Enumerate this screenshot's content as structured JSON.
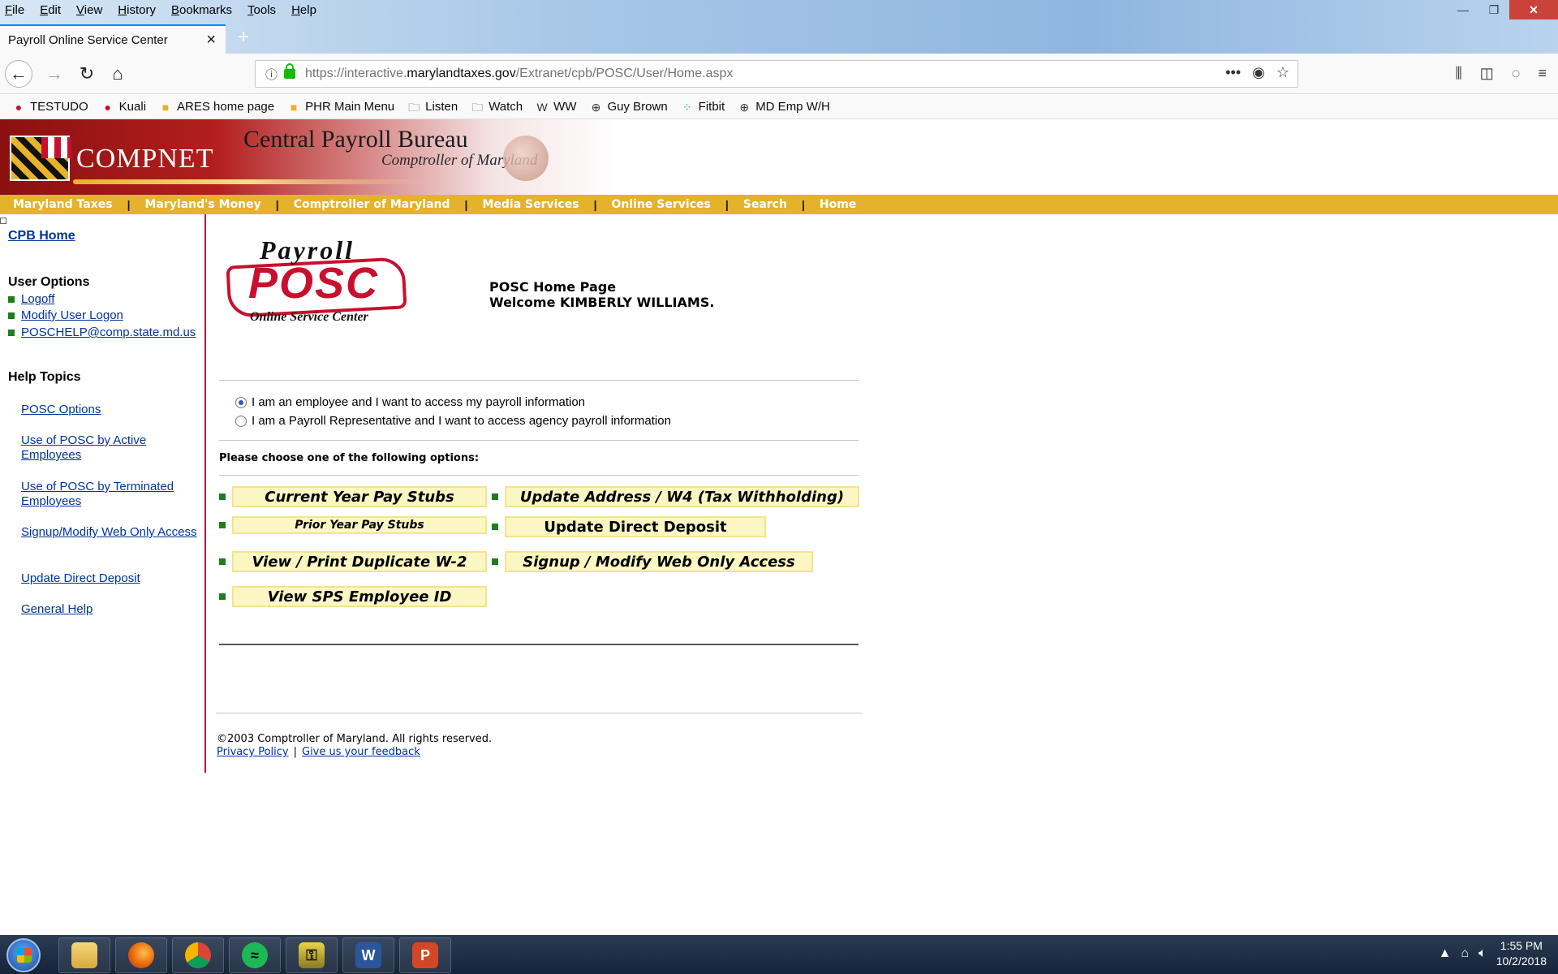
{
  "browser": {
    "menu": [
      "File",
      "Edit",
      "View",
      "History",
      "Bookmarks",
      "Tools",
      "Help"
    ],
    "tab_title": "Payroll Online Service Center",
    "url_prefix": "https://interactive.",
    "url_domain": "marylandtaxes.gov",
    "url_path": "/Extranet/cpb/POSC/User/Home.aspx",
    "bookmarks": [
      {
        "label": "TESTUDO",
        "icon": "umd-icon",
        "glyph": "●",
        "color": "#c8102e"
      },
      {
        "label": "Kuali",
        "icon": "umd-icon",
        "glyph": "●",
        "color": "#c8102e"
      },
      {
        "label": "ARES home page",
        "icon": "md-flag-icon",
        "glyph": "■",
        "color": "#e5b22b"
      },
      {
        "label": "PHR Main Menu",
        "icon": "md-flag-icon",
        "glyph": "■",
        "color": "#e5b22b"
      },
      {
        "label": "Listen",
        "icon": "folder-icon",
        "glyph": "🗀",
        "color": "#555555"
      },
      {
        "label": "Watch",
        "icon": "folder-icon",
        "glyph": "🗀",
        "color": "#555555"
      },
      {
        "label": "WW",
        "icon": "ww-icon",
        "glyph": "W",
        "color": "#333333"
      },
      {
        "label": "Guy Brown",
        "icon": "globe-icon",
        "glyph": "⊕",
        "color": "#333333"
      },
      {
        "label": "Fitbit",
        "icon": "fitbit-icon",
        "glyph": "⁘",
        "color": "#00b0b9"
      },
      {
        "label": "MD Emp W/H",
        "icon": "globe-icon",
        "glyph": "⊕",
        "color": "#333333"
      }
    ]
  },
  "banner": {
    "brand": "COMPNET",
    "title": "Central Payroll Bureau",
    "subtitle": "Comptroller of Maryland"
  },
  "nav": [
    "Maryland Taxes",
    "Maryland's Money",
    "Comptroller of Maryland",
    "Media Services",
    "Online Services",
    "Search",
    "Home"
  ],
  "sidebar": {
    "cpb_home": "CPB Home",
    "user_options_heading": "User Options",
    "user_options": [
      "Logoff",
      "Modify User Logon",
      "POSCHELP@comp.state.md.us"
    ],
    "help_heading": "Help Topics",
    "help_topics": [
      "POSC Options",
      "Use of POSC by Active Employees",
      "Use of POSC by Terminated Employees",
      "Signup/Modify Web Only Access",
      "Update Direct Deposit",
      "General Help"
    ]
  },
  "logo": {
    "top": "Payroll",
    "main": "POSC",
    "bottom": "Online Service Center"
  },
  "main": {
    "page_title": "POSC Home Page",
    "welcome": "Welcome KIMBERLY WILLIAMS.",
    "radio_employee": "I am an employee and I want to access my payroll information",
    "radio_rep": "I am a Payroll Representative and I want to access agency payroll information",
    "selected_radio": "employee",
    "choose_text": "Please choose one of the following options:",
    "options": {
      "current_year": "Current Year Pay Stubs",
      "update_address": "Update Address / W4 (Tax Withholding)",
      "prior_year": "Prior Year Pay Stubs",
      "direct_deposit": "Update Direct Deposit",
      "duplicate_w2": "View / Print Duplicate W-2",
      "web_access": "Signup / Modify Web Only Access",
      "sps_id": "View SPS Employee ID"
    }
  },
  "footer": {
    "copyright": "©2003 Comptroller of Maryland. All rights reserved.",
    "privacy": "Privacy Policy",
    "separator": "|",
    "feedback": "Give us your feedback"
  },
  "taskbar": {
    "apps": [
      "file-explorer-icon",
      "firefox-icon",
      "chrome-icon",
      "spotify-icon",
      "keepass-icon",
      "word-icon",
      "powerpoint-icon"
    ],
    "time": "1:55 PM",
    "date": "10/2/2018"
  }
}
